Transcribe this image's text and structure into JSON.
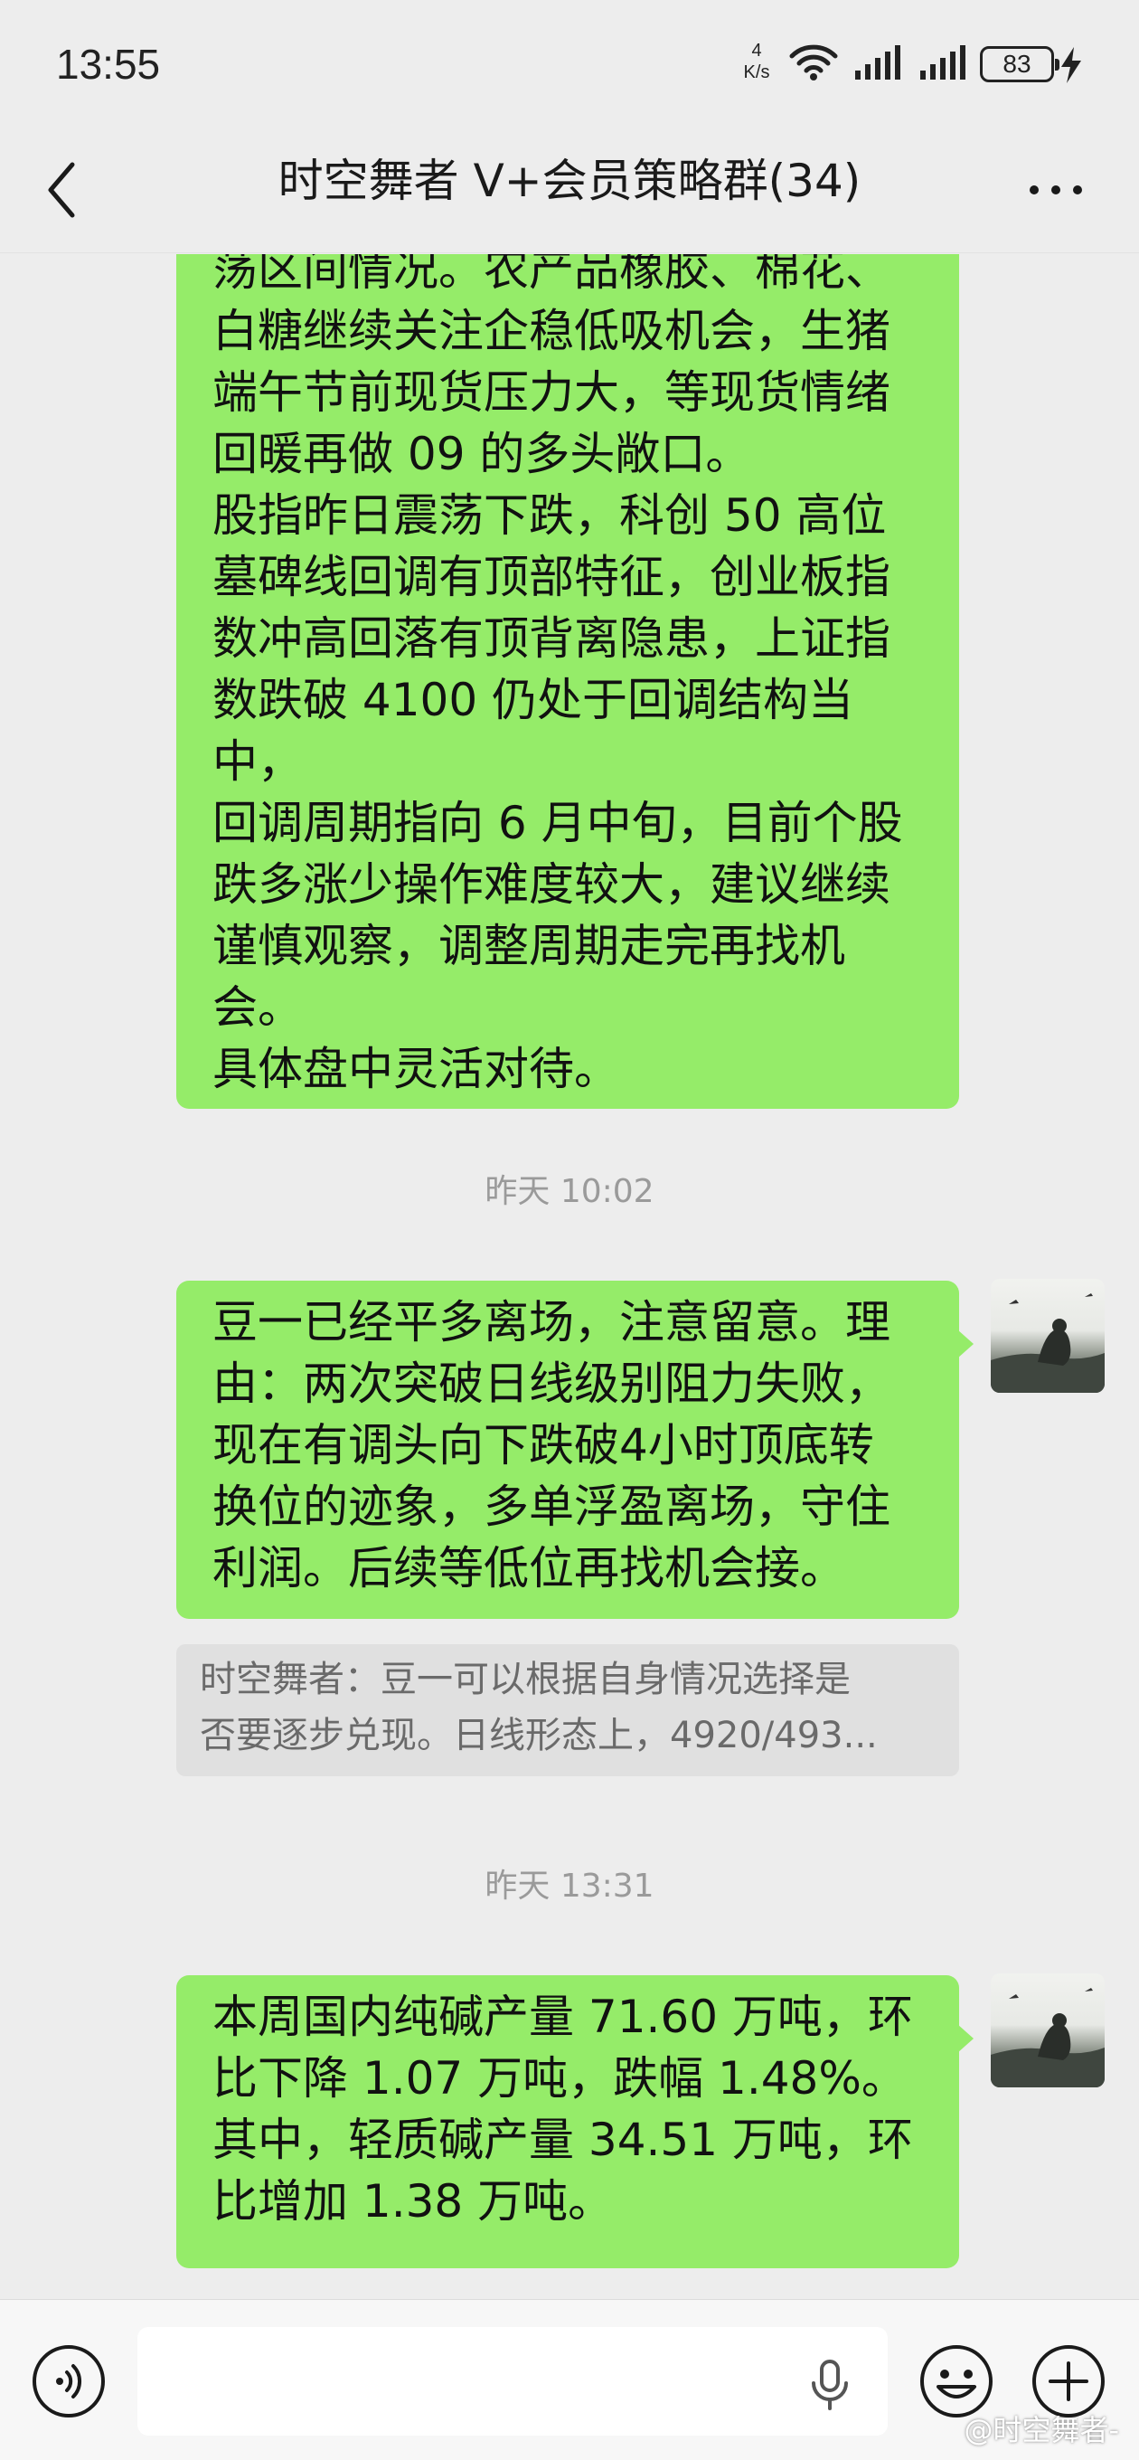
{
  "status_bar": {
    "time": "13:55",
    "net_speed_value": "4",
    "net_speed_unit": "K/s",
    "battery": "83"
  },
  "header": {
    "title": "时空舞者 V+会员策略群(34)"
  },
  "messages": [
    {
      "text": "荡区间情况。农产品橡胶、棉花、\n白糖继续关注企稳低吸机会，生猪\n端午节前现货压力大，等现货情绪\n回暖再做 09 的多头敞口。\n股指昨日震荡下跌，科创 50 高位\n墓碑线回调有顶部特征，创业板指\n数冲高回落有顶背离隐患，上证指\n数跌破 4100 仍处于回调结构当中，\n回调周期指向 6 月中旬，目前个股\n跌多涨少操作难度较大，建议继续\n谨慎观察，调整周期走完再找机\n会。\n具体盘中灵活对待。"
    },
    {
      "time": "昨天 10:02",
      "text": "豆一已经平多离场，注意留意。理\n由：两次突破日线级别阻力失败，\n现在有调头向下跌破4小时顶底转\n换位的迹象，多单浮盈离场，守住\n利润。后续等低位再找机会接。",
      "quote_line1": "时空舞者：豆一可以根据自身情况选择是",
      "quote_line2": "否要逐步兑现。日线形态上，4920/493..."
    },
    {
      "time": "昨天 13:31",
      "text": "本周国内纯碱产量 71.60 万吨，环\n比下降 1.07 万吨，跌幅 1.48%。\n其中，轻质碱产量 34.51 万吨，环\n比增加 1.38 万吨。"
    }
  ],
  "input": {
    "placeholder": ""
  },
  "watermark": "@时空舞者-",
  "colors": {
    "bubble": "#95ec69",
    "background": "#ededed",
    "input_bar": "#f7f7f7",
    "timestamp": "#9a9a9a"
  },
  "icons": [
    "back-icon",
    "more-icon",
    "wifi-icon",
    "signal-icon",
    "bolt-icon",
    "voice-icon",
    "mic-icon",
    "emoji-icon",
    "plus-icon"
  ]
}
